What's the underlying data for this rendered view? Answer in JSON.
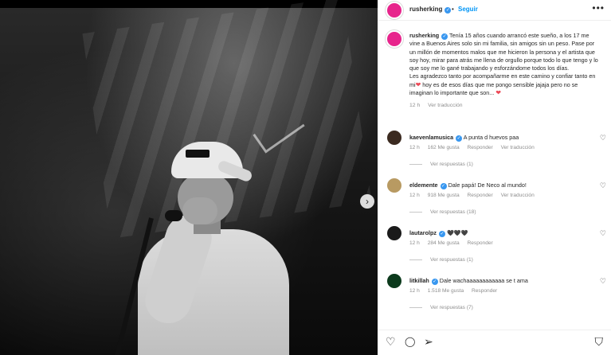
{
  "photo": {
    "next_icon": "chevron-right-icon",
    "next_glyph": "›"
  },
  "header": {
    "username": "rusherking",
    "separator": "•",
    "follow_label": "Seguir",
    "more_glyph": "•••",
    "verified_glyph": "✓",
    "avatar_color": "#e7248c"
  },
  "caption": {
    "username": "rusherking",
    "text_part1": "Tenía 15 años cuando arrancó este sueño, a los 17 me vine a Buenos Aires solo sin mi familia, sin amigos sin un peso. Pase por un millón de momentos malos que me hicieron la persona y el artista que soy hoy, mirar para atrás me llena de orgullo porque todo lo que tengo y lo que soy me lo gané trabajando y esforzándome todos los días.",
    "text_part2": "Les agradezco tanto por acompañarme en este camino y confiar tanto en mi",
    "text_part3": " hoy es de esos días que me pongo sensible jajaja pero no se imaginan lo importante que son...",
    "heart_glyph": "❤",
    "time": "12 h",
    "translate": "Ver traducción"
  },
  "comments": [
    {
      "username": "kaevenlamusica",
      "text": "A punta d huevos paa",
      "time": "12 h",
      "likes": "162 Me gusta",
      "reply": "Responder",
      "translate": "Ver traducción",
      "replies": "Ver respuestas (1)",
      "avatar_color": "#3b2a20"
    },
    {
      "username": "eldemente",
      "text": "Dale papá! De Neco al mundo!",
      "time": "12 h",
      "likes": "918 Me gusta",
      "reply": "Responder",
      "translate": "Ver traducción",
      "replies": "Ver respuestas (18)",
      "avatar_color": "#b89a62"
    },
    {
      "username": "lautarolpz",
      "text": "🖤🖤🖤",
      "time": "12 h",
      "likes": "284 Me gusta",
      "reply": "Responder",
      "translate": "",
      "replies": "Ver respuestas (1)",
      "avatar_color": "#1a1a1a"
    },
    {
      "username": "litkillah",
      "text": "Dale wachaaaaaaaaaaaa se t ama",
      "time": "12 h",
      "likes": "1.518 Me gusta",
      "reply": "Responder",
      "translate": "",
      "replies": "Ver respuestas (7)",
      "avatar_color": "#0c3a1c"
    }
  ],
  "actions": {
    "like_icon": "heart-icon",
    "comment_icon": "comment-icon",
    "share_icon": "share-icon",
    "save_icon": "bookmark-icon",
    "like_glyph": "♡",
    "comment_glyph": "◯",
    "share_glyph": "➢",
    "save_glyph": "⛉",
    "comment_heart_glyph": "♡"
  }
}
